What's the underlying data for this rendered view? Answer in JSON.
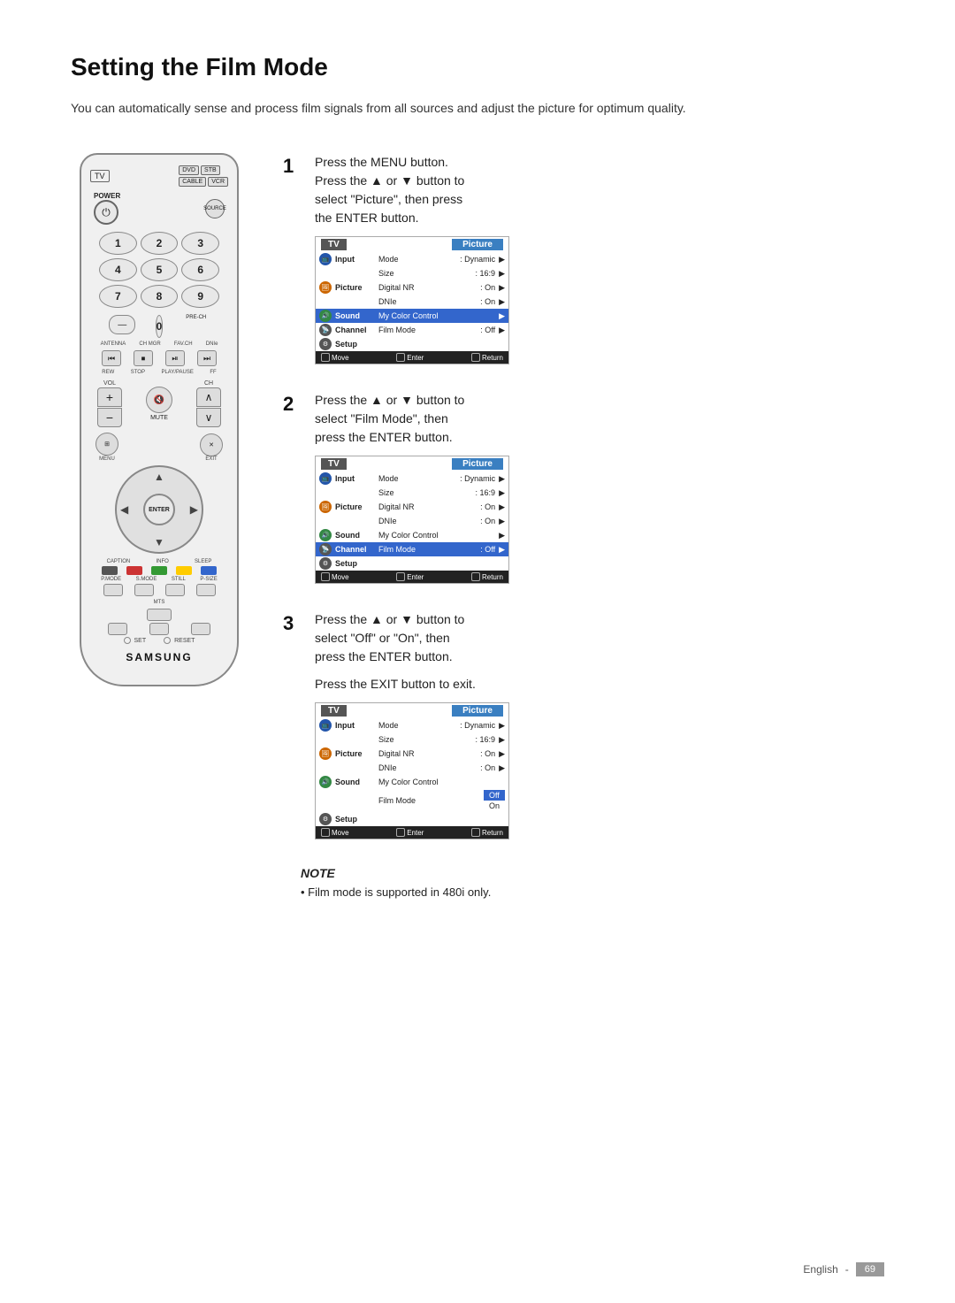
{
  "page": {
    "title": "Setting the Film Mode",
    "intro": "You can automatically sense and process film signals from all sources and adjust the picture for optimum quality.",
    "footer": {
      "lang": "English",
      "page": "69"
    }
  },
  "remote": {
    "tv_label": "TV",
    "dvd_label": "DVD",
    "stb_label": "STB",
    "cable_label": "CABLE",
    "vcr_label": "VCR",
    "power_label": "POWER",
    "source_label": "SOURCE",
    "samsung_label": "SAMSUNG",
    "enter_label": "ENTER",
    "menu_label": "MENU",
    "exit_label": "EXIT",
    "mute_label": "MUTE",
    "pre_ch_label": "PRE-CH",
    "vol_label": "VOL",
    "ch_label": "CH",
    "caption_label": "CAPTION",
    "info_label": "INFO",
    "sleep_label": "SLEEP",
    "mts_label": "MTS",
    "set_label": "SET",
    "reset_label": "RESET",
    "pmode_label": "P.MODE",
    "smode_label": "S.MODE",
    "still_label": "STILL",
    "psize_label": "P-SIZE",
    "buttons": [
      "1",
      "2",
      "3",
      "4",
      "5",
      "6",
      "7",
      "8",
      "9",
      "0"
    ]
  },
  "steps": [
    {
      "number": "1",
      "lines": [
        "Press the MENU button.",
        "Press the ▲ or ▼ button to",
        "select \"Picture\", then press",
        "the ENTER button."
      ]
    },
    {
      "number": "2",
      "lines": [
        "Press the ▲ or ▼ button to",
        "select \"Film Mode\", then",
        "press the ENTER button."
      ]
    },
    {
      "number": "3",
      "lines": [
        "Press the ▲ or ▼ button to",
        "select \"Off\" or \"On\", then",
        "press the ENTER button."
      ],
      "extra_line": "Press the EXIT button to exit."
    }
  ],
  "screens": [
    {
      "header_left": "TV",
      "header_right": "Picture",
      "menu_items": [
        {
          "icon": "input",
          "label": "Input",
          "text": "Mode",
          "value": ": Dynamic",
          "arrow": "▶"
        },
        {
          "icon": "",
          "label": "",
          "text": "Size",
          "value": ": 16:9",
          "arrow": "▶"
        },
        {
          "icon": "picture",
          "label": "Picture",
          "text": "Digital NR",
          "value": ": On",
          "arrow": "▶"
        },
        {
          "icon": "",
          "label": "",
          "text": "DNIe",
          "value": ": On",
          "arrow": "▶"
        },
        {
          "icon": "sound",
          "label": "Sound",
          "text": "My Color Control",
          "value": "",
          "arrow": "▶"
        },
        {
          "icon": "channel",
          "label": "Channel",
          "text": "Film Mode",
          "value": ": Off",
          "arrow": "▶"
        },
        {
          "icon": "setup",
          "label": "Setup",
          "text": "",
          "value": "",
          "arrow": ""
        }
      ],
      "footer": [
        "Move",
        "Enter",
        "Return"
      ],
      "selected": "Sound"
    },
    {
      "header_left": "TV",
      "header_right": "Picture",
      "menu_items": [
        {
          "icon": "input",
          "label": "Input",
          "text": "Mode",
          "value": ": Dynamic",
          "arrow": "▶"
        },
        {
          "icon": "",
          "label": "",
          "text": "Size",
          "value": ": 16:9",
          "arrow": "▶"
        },
        {
          "icon": "picture",
          "label": "Picture",
          "text": "Digital NR",
          "value": ": On",
          "arrow": "▶"
        },
        {
          "icon": "",
          "label": "",
          "text": "DNIe",
          "value": ": On",
          "arrow": "▶"
        },
        {
          "icon": "sound",
          "label": "Sound",
          "text": "My Color Control",
          "value": "",
          "arrow": "▶"
        },
        {
          "icon": "channel",
          "label": "Channel",
          "text": "Film Mode",
          "value": ": Off",
          "arrow": "▶"
        },
        {
          "icon": "setup",
          "label": "Setup",
          "text": "",
          "value": "",
          "arrow": ""
        }
      ],
      "footer": [
        "Move",
        "Enter",
        "Return"
      ],
      "selected": "Film Mode"
    },
    {
      "header_left": "TV",
      "header_right": "Picture",
      "menu_items": [
        {
          "icon": "input",
          "label": "Input",
          "text": "Mode",
          "value": ": Dynamic",
          "arrow": "▶"
        },
        {
          "icon": "",
          "label": "",
          "text": "Size",
          "value": ": 16:9",
          "arrow": "▶"
        },
        {
          "icon": "picture",
          "label": "Picture",
          "text": "Digital NR",
          "value": ": On",
          "arrow": "▶"
        },
        {
          "icon": "",
          "label": "",
          "text": "DNIe",
          "value": ": On",
          "arrow": "▶"
        },
        {
          "icon": "sound",
          "label": "Sound",
          "text": "My Color Control",
          "value": "",
          "arrow": ""
        },
        {
          "icon": "",
          "label": "",
          "text": "Film Mode",
          "value": "",
          "arrow": ""
        }
      ],
      "dropdown": [
        "Off",
        "On"
      ],
      "dropdown_selected": "Off",
      "footer": [
        "Move",
        "Enter",
        "Return"
      ],
      "selected": "Film Mode dropdown"
    }
  ],
  "note": {
    "title": "NOTE",
    "bullet": "Film mode is supported in 480i only."
  }
}
